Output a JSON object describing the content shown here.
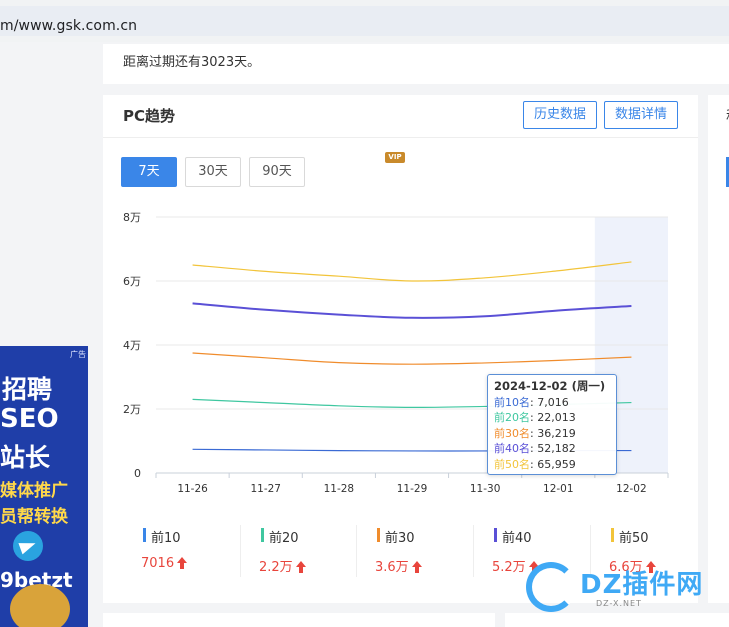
{
  "browser": {
    "url": "m/www.gsk.com.cn"
  },
  "top_card": {
    "expire_text": "距离过期还有3023天。"
  },
  "pc_trend": {
    "title": "PC趋势",
    "history_button": "历史数据",
    "detail_button": "数据详情",
    "ranges": [
      "7天",
      "30天",
      "90天"
    ],
    "active_range": "7天",
    "vip_badge": "VIP"
  },
  "right_card": {
    "title_partial": "移"
  },
  "chart_data": {
    "type": "line",
    "categories": [
      "11-26",
      "11-27",
      "11-28",
      "11-29",
      "11-30",
      "12-01",
      "12-02"
    ],
    "y_tick_labels": [
      "0",
      "2万",
      "4万",
      "6万",
      "8万"
    ],
    "ylim": [
      0,
      80000
    ],
    "grid": true,
    "highlight_category": "12-02",
    "series": [
      {
        "name": "前10",
        "color": "#3a6ad4",
        "values": [
          7400,
          7200,
          7000,
          6900,
          6900,
          7000,
          7016
        ]
      },
      {
        "name": "前20",
        "color": "#3fc7a0",
        "values": [
          23000,
          22000,
          21000,
          20500,
          20800,
          21400,
          22013
        ]
      },
      {
        "name": "前30",
        "color": "#f08c2c",
        "values": [
          37500,
          36000,
          34500,
          34000,
          34400,
          35200,
          36219
        ]
      },
      {
        "name": "前40",
        "color": "#5a50d6",
        "values": [
          53000,
          51000,
          49500,
          48500,
          49000,
          50800,
          52182
        ]
      },
      {
        "name": "前50",
        "color": "#f2c43a",
        "values": [
          65000,
          63000,
          61500,
          60000,
          61000,
          63200,
          65959
        ]
      }
    ]
  },
  "tooltip": {
    "title": "2024-12-02 (周一)",
    "rows": [
      {
        "label": "前10名",
        "value": "7,016",
        "color": "#3a6ad4"
      },
      {
        "label": "前20名",
        "value": "22,013",
        "color": "#3fc7a0"
      },
      {
        "label": "前30名",
        "value": "36,219",
        "color": "#f08c2c"
      },
      {
        "label": "前40名",
        "value": "52,182",
        "color": "#5a50d6"
      },
      {
        "label": "前50名",
        "value": "65,959",
        "color": "#f2c43a"
      }
    ]
  },
  "legend": [
    {
      "name": "前10",
      "value": "7016",
      "color": "#3a86e8"
    },
    {
      "name": "前20",
      "value": "2.2万",
      "color": "#3fc7a0"
    },
    {
      "name": "前30",
      "value": "3.6万",
      "color": "#f08c2c"
    },
    {
      "name": "前40",
      "value": "5.2万",
      "color": "#5a50d6"
    },
    {
      "name": "前50",
      "value": "6.6万",
      "color": "#f2c43a"
    }
  ],
  "ad": {
    "tag": "广告",
    "lines": [
      "招聘",
      "SEO",
      "站长",
      "媒体推广",
      "员帮转换",
      "9betzt"
    ]
  },
  "watermark": {
    "text": "DZ插件网",
    "sub": "DZ-X.NET"
  }
}
